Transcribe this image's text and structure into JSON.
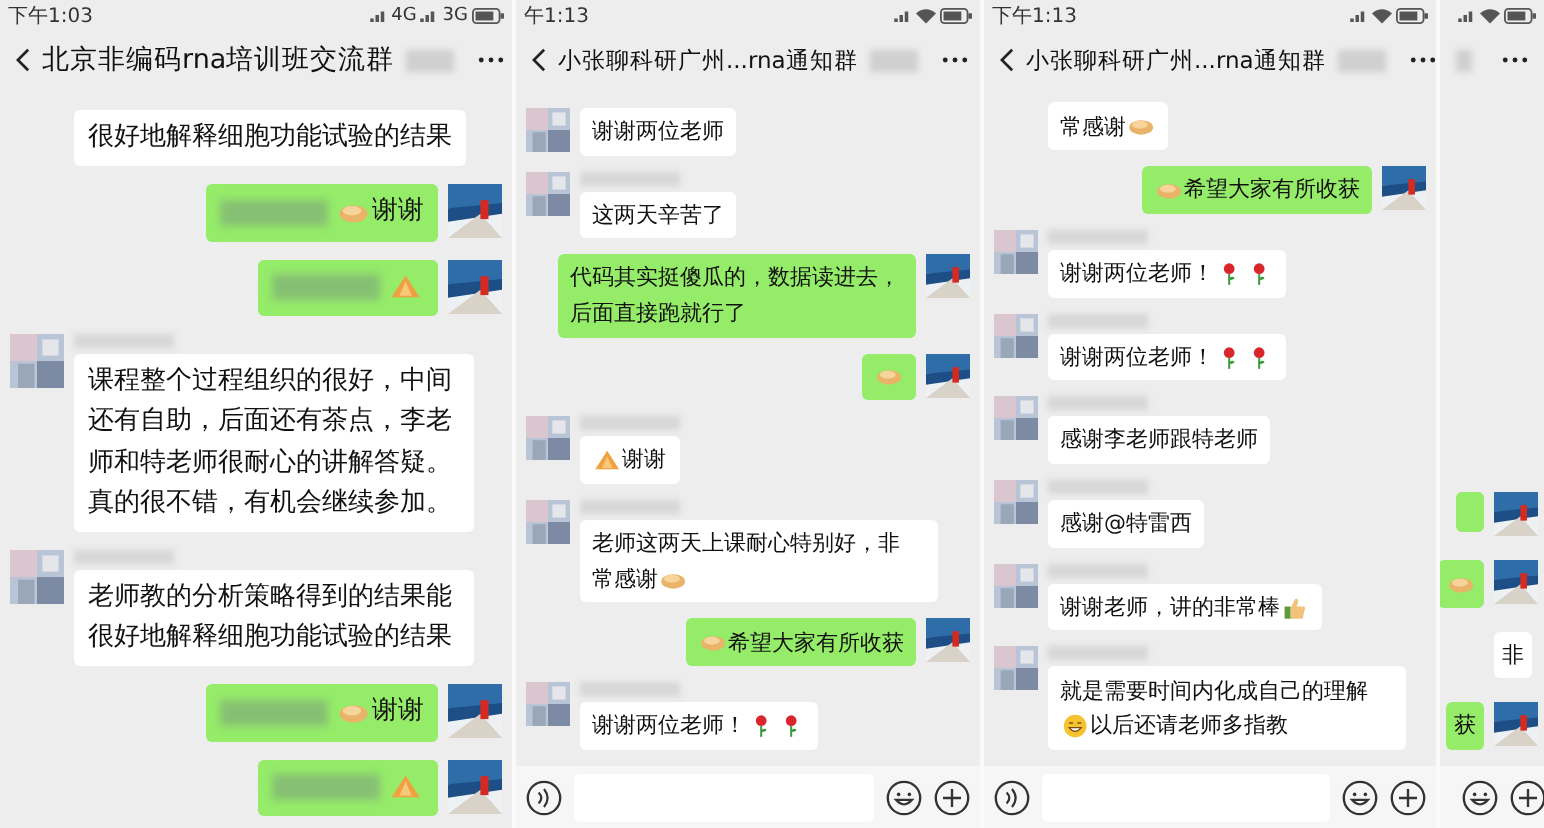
{
  "panels": [
    {
      "kind": "chat",
      "status": {
        "time": "下午1:03",
        "network": [
          "4G",
          "3G"
        ]
      },
      "title": {
        "text": "北京非编码rna培训班交流群",
        "blurred_suffix": true
      },
      "input_bar": false,
      "messages": [
        {
          "kind": "incoming",
          "avatar": false,
          "blurred_name": false,
          "parts": [
            {
              "kind": "text",
              "text": "很好地解释细胞功能试验的结果"
            }
          ]
        },
        {
          "kind": "outgoing",
          "avatar": true,
          "blurred_name": false,
          "parts": [
            {
              "kind": "blur"
            },
            {
              "kind": "bun"
            },
            {
              "kind": "text",
              "text": "谢谢"
            }
          ]
        },
        {
          "kind": "outgoing",
          "avatar": true,
          "blurred_name": false,
          "parts": [
            {
              "kind": "blur"
            },
            {
              "kind": "hands"
            }
          ]
        },
        {
          "kind": "incoming",
          "avatar": true,
          "blurred_name": true,
          "parts": [
            {
              "kind": "text",
              "text": "课程整个过程组织的很好，中间还有自助，后面还有茶点，李老师和特老师很耐心的讲解答疑。真的很不错，有机会继续参加。"
            }
          ]
        },
        {
          "kind": "incoming",
          "avatar": true,
          "blurred_name": true,
          "parts": [
            {
              "kind": "text",
              "text": "老师教的分析策略得到的结果能很好地解释细胞功能试验的结果"
            }
          ]
        },
        {
          "kind": "outgoing",
          "avatar": true,
          "blurred_name": false,
          "parts": [
            {
              "kind": "blur"
            },
            {
              "kind": "bun"
            },
            {
              "kind": "text",
              "text": "谢谢"
            }
          ]
        },
        {
          "kind": "outgoing",
          "avatar": true,
          "blurred_name": false,
          "parts": [
            {
              "kind": "blur"
            },
            {
              "kind": "hands"
            }
          ]
        }
      ]
    },
    {
      "kind": "chat",
      "status": {
        "time": "午1:13"
      },
      "title": {
        "text": "小张聊科研广州...rna通知群",
        "blurred_suffix": true
      },
      "input_bar": true,
      "messages": [
        {
          "kind": "incoming",
          "avatar": true,
          "blurred_name": false,
          "parts": [
            {
              "kind": "text",
              "text": "谢谢两位老师"
            }
          ]
        },
        {
          "kind": "incoming",
          "avatar": true,
          "blurred_name": true,
          "parts": [
            {
              "kind": "text",
              "text": "这两天辛苦了"
            }
          ]
        },
        {
          "kind": "outgoing",
          "avatar": true,
          "blurred_name": false,
          "parts": [
            {
              "kind": "text",
              "text": "代码其实挺傻瓜的，数据读进去，后面直接跑就行了"
            }
          ]
        },
        {
          "kind": "outgoing",
          "avatar": true,
          "blurred_name": false,
          "parts": [
            {
              "kind": "bun"
            }
          ]
        },
        {
          "kind": "incoming",
          "avatar": true,
          "blurred_name": true,
          "parts": [
            {
              "kind": "hands"
            },
            {
              "kind": "text",
              "text": "谢谢"
            }
          ]
        },
        {
          "kind": "incoming",
          "avatar": true,
          "blurred_name": true,
          "parts": [
            {
              "kind": "text",
              "text": "老师这两天上课耐心特别好，非"
            },
            {
              "kind": "text",
              "text": "常感谢"
            },
            {
              "kind": "bun"
            }
          ]
        },
        {
          "kind": "outgoing",
          "avatar": true,
          "blurred_name": false,
          "parts": [
            {
              "kind": "bun"
            },
            {
              "kind": "text",
              "text": "希望大家有所收获"
            }
          ]
        },
        {
          "kind": "incoming",
          "avatar": true,
          "blurred_name": true,
          "parts": [
            {
              "kind": "text",
              "text": "谢谢两位老师！"
            },
            {
              "kind": "rose"
            },
            {
              "kind": "rose"
            }
          ]
        }
      ]
    },
    {
      "kind": "chat",
      "status": {
        "time": "下午1:13"
      },
      "title": {
        "text": "小张聊科研广州...rna通知群",
        "blurred_suffix": true
      },
      "input_bar": true,
      "messages": [
        {
          "kind": "incoming",
          "avatar": false,
          "blurred_name": false,
          "parts": [
            {
              "kind": "text",
              "text": "常感谢"
            },
            {
              "kind": "bun"
            }
          ]
        },
        {
          "kind": "outgoing",
          "avatar": true,
          "blurred_name": false,
          "parts": [
            {
              "kind": "bun"
            },
            {
              "kind": "text",
              "text": "希望大家有所收获"
            }
          ]
        },
        {
          "kind": "incoming",
          "avatar": true,
          "blurred_name": true,
          "parts": [
            {
              "kind": "text",
              "text": "谢谢两位老师！"
            },
            {
              "kind": "rose"
            },
            {
              "kind": "rose"
            }
          ]
        },
        {
          "kind": "incoming",
          "avatar": true,
          "blurred_name": true,
          "parts": [
            {
              "kind": "text",
              "text": "谢谢两位老师！"
            },
            {
              "kind": "rose"
            },
            {
              "kind": "rose"
            }
          ]
        },
        {
          "kind": "incoming",
          "avatar": true,
          "blurred_name": true,
          "parts": [
            {
              "kind": "text",
              "text": "感谢李老师跟特老师"
            }
          ]
        },
        {
          "kind": "incoming",
          "avatar": true,
          "blurred_name": true,
          "parts": [
            {
              "kind": "text",
              "text": "感谢@特雷西"
            }
          ]
        },
        {
          "kind": "incoming",
          "avatar": true,
          "blurred_name": true,
          "parts": [
            {
              "kind": "text",
              "text": "谢谢老师，讲的非常棒"
            },
            {
              "kind": "thumb"
            }
          ]
        },
        {
          "kind": "incoming",
          "avatar": true,
          "blurred_name": true,
          "parts": [
            {
              "kind": "text",
              "text": "就是需要时间内化成自己的理解"
            },
            {
              "kind": "grin"
            },
            {
              "kind": "text",
              "text": "以后还请老师多指教"
            }
          ]
        }
      ]
    },
    {
      "kind": "sliver",
      "input_bar": true,
      "messages": [
        {
          "kind": "outgoing",
          "avatar": true,
          "blurred_name": false
        },
        {
          "kind": "outgoing",
          "avatar": true,
          "blurred_name": false,
          "parts": [
            {
              "kind": "bun"
            }
          ]
        },
        {
          "kind": "incoming",
          "avatar": false,
          "blurred_name": false,
          "parts": [
            {
              "kind": "text",
              "text": "非"
            }
          ]
        },
        {
          "kind": "outgoing",
          "avatar": true,
          "blurred_name": false,
          "parts": [
            {
              "kind": "text",
              "text": "获"
            }
          ]
        }
      ]
    }
  ]
}
